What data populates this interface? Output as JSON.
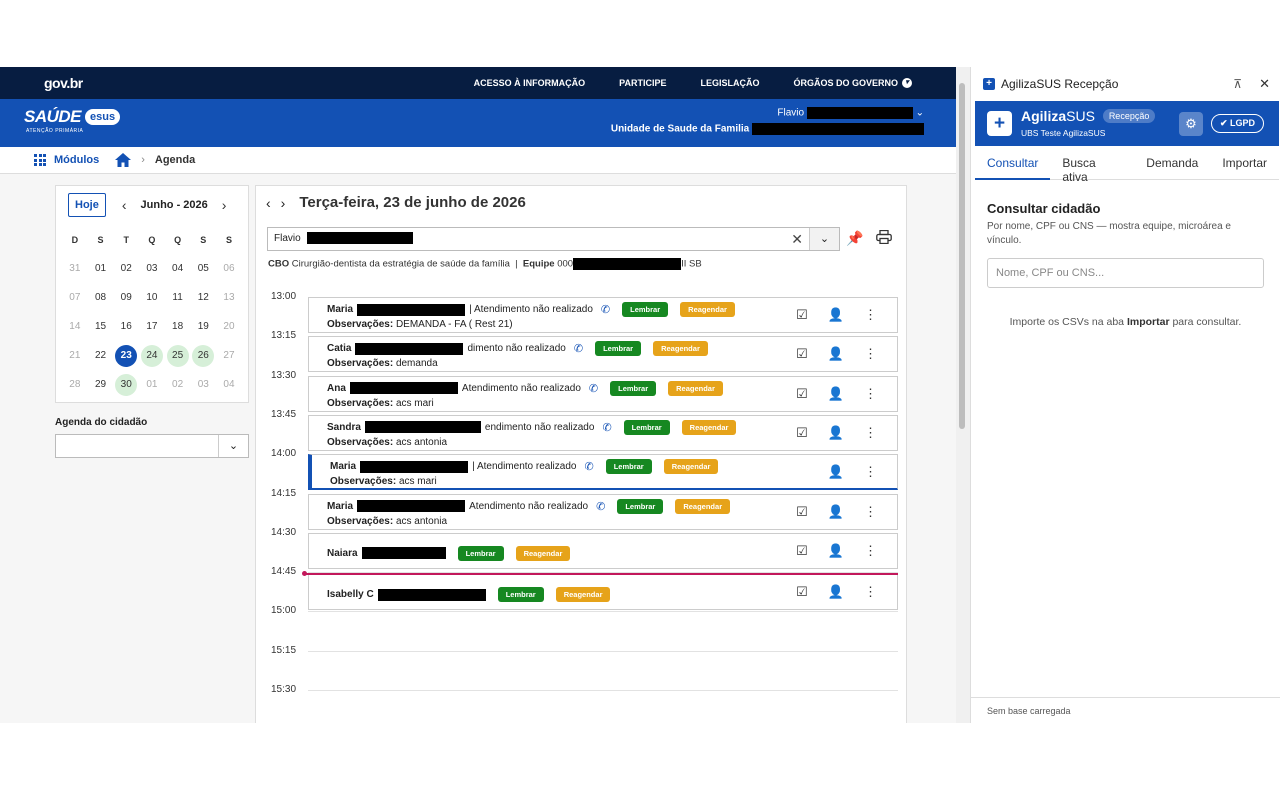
{
  "gov": {
    "logo": "gov.br",
    "links": [
      "ACESSO À INFORMAÇÃO",
      "PARTICIPE",
      "LEGISLAÇÃO",
      "ÓRGÃOS DO GOVERNO"
    ]
  },
  "header": {
    "brand": "SAÚDE",
    "brand_sub": "ATENÇÃO PRIMÁRIA",
    "esus": "esus",
    "user": "Flavio",
    "unit": "Unidade de Saude da Familia"
  },
  "breadcrumb": {
    "modules": "Módulos",
    "current": "Agenda"
  },
  "calendar": {
    "today_btn": "Hoje",
    "month": "Junho - 2026",
    "weekdays": [
      "D",
      "S",
      "T",
      "Q",
      "Q",
      "S",
      "S"
    ],
    "days": [
      "31",
      "01",
      "02",
      "03",
      "04",
      "05",
      "06",
      "07",
      "08",
      "09",
      "10",
      "11",
      "12",
      "13",
      "14",
      "15",
      "16",
      "17",
      "18",
      "19",
      "20",
      "21",
      "22",
      "23",
      "24",
      "25",
      "26",
      "27",
      "28",
      "29",
      "30",
      "01",
      "02",
      "03",
      "04"
    ]
  },
  "agenda_cidadao": {
    "label": "Agenda do cidadão",
    "value": ""
  },
  "schedule": {
    "title": "Terça-feira, 23 de junho de 2026",
    "professional": "Flavio",
    "cbo_label": "CBO",
    "cbo_value": "Cirurgião-dentista da estratégia de saúde da família",
    "equipe_label": "Equipe",
    "equipe_prefix": "000",
    "equipe_suffix": "II SB",
    "times": [
      "13:00",
      "13:15",
      "13:30",
      "13:45",
      "14:00",
      "14:15",
      "14:30",
      "14:45",
      "15:00",
      "15:15",
      "15:30"
    ],
    "tag_lembrar": "Lembrar",
    "tag_reagendar": "Reagendar",
    "obs_label": "Observações:",
    "appointments": [
      {
        "name": "Maria",
        "status": "| Atendimento não realizado",
        "obs": "DEMANDA - FA ( Rest 21)"
      },
      {
        "name": "Catia",
        "status": "dimento não realizado",
        "obs": "demanda"
      },
      {
        "name": "Ana",
        "status": "Atendimento não realizado",
        "obs": "acs mari"
      },
      {
        "name": "Sandra",
        "status": "endimento não realizado",
        "obs": "acs antonia"
      },
      {
        "name": "Maria",
        "status": "| Atendimento realizado",
        "obs": "acs mari"
      },
      {
        "name": "Maria",
        "status": "Atendimento não realizado",
        "obs": "acs antonia"
      },
      {
        "name": "Naiara",
        "status": "",
        "obs": ""
      },
      {
        "name": "Isabelly C",
        "status": "",
        "obs": ""
      }
    ]
  },
  "side": {
    "window_title": "AgilizaSUS Recepção",
    "brand_bold": "Agiliza",
    "brand_rest": "SUS",
    "badge": "Recepção",
    "sub": "UBS Teste AgilizaSUS",
    "lgpd": "LGPD",
    "tabs": [
      "Consultar",
      "Busca ativa",
      "Demanda",
      "Importar"
    ],
    "title": "Consultar cidadão",
    "desc": "Por nome, CPF ou CNS — mostra equipe, microárea e vínculo.",
    "placeholder": "Nome, CPF ou CNS...",
    "hint_pre": "Importe os CSVs na aba",
    "hint_bold": "Importar",
    "hint_post": "para consultar.",
    "footer": "Sem base carregada"
  }
}
